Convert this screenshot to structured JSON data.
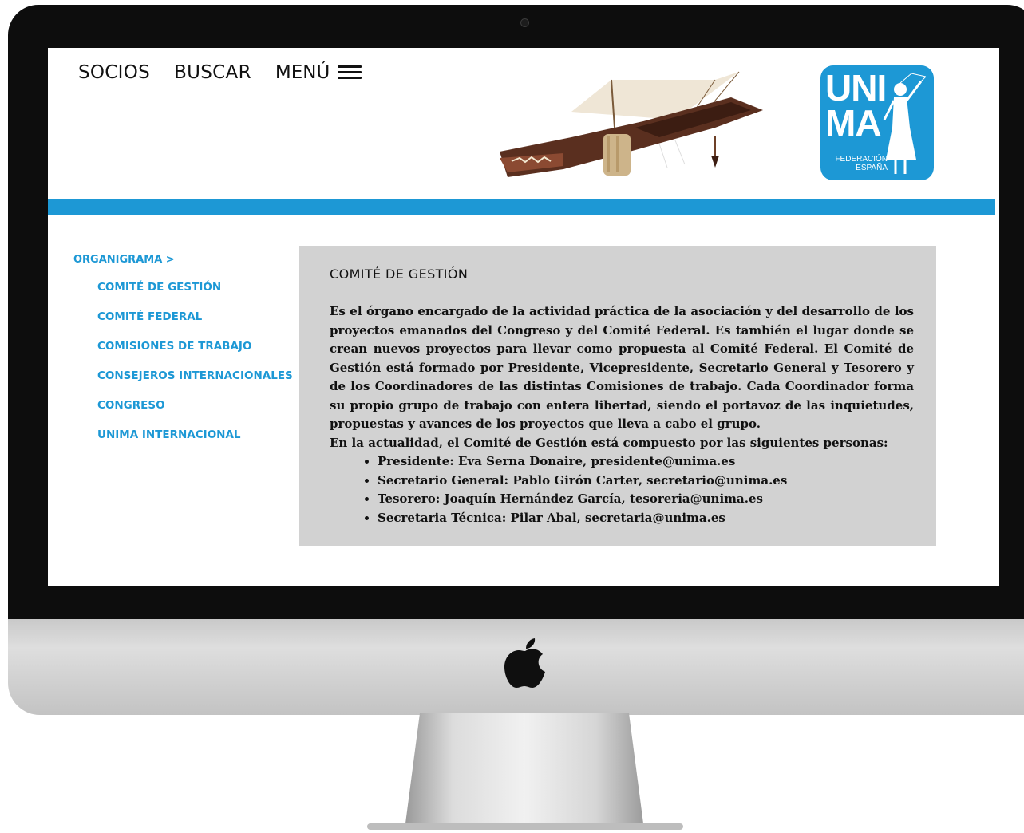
{
  "nav": {
    "socios": "SOCIOS",
    "buscar": "BUSCAR",
    "menu": "MENÚ"
  },
  "logo": {
    "line1": "UNI",
    "line2": "MA",
    "sub1": "FEDERACIÓN",
    "sub2": "ESPAÑA"
  },
  "sidebar": {
    "heading": "ORGANIGRAMA >",
    "items": [
      "COMITÉ DE GESTIÓN",
      "COMITÉ FEDERAL",
      "COMISIONES DE TRABAJO",
      "CONSEJEROS INTERNACIONALES",
      "CONGRESO",
      "UNIMA INTERNACIONAL"
    ]
  },
  "content": {
    "title": "COMITÉ DE GESTIÓN",
    "paragraph": "Es el órgano encargado de la actividad práctica de la asociación y del desarrollo de los proyectos emanados del Congreso y del Comité Federal. Es también el lugar donde se crean nuevos proyectos para llevar como propuesta al Comité Federal. El Comité de Gestión está formado por Presidente, Vicepresidente, Secretario General y Tesorero y de los Coordinadores de las distintas Comisiones de trabajo. Cada Coordinador forma su propio grupo de trabajo con entera libertad, siendo el portavoz de las inquietudes, propuestas y avances de los proyectos que lleva a cabo el grupo.",
    "intro": "En la actualidad, el Comité de Gestión está compuesto por las siguientes personas:",
    "members": [
      "Presidente: Eva Serna Donaire, presidente@unima.es",
      "Secretario General: Pablo Girón Carter, secretario@unima.es",
      "Tesorero: Joaquín Hernández García, tesoreria@unima.es",
      "Secretaria Técnica: Pilar Abal, secretaria@unima.es"
    ]
  },
  "colors": {
    "accent": "#1d98d5",
    "content_bg": "#d2d2d2",
    "bezel": "#0d0d0d"
  },
  "icons": {
    "menu": "hamburger-icon",
    "device": "apple-logo-icon",
    "camera": "camera-icon"
  }
}
